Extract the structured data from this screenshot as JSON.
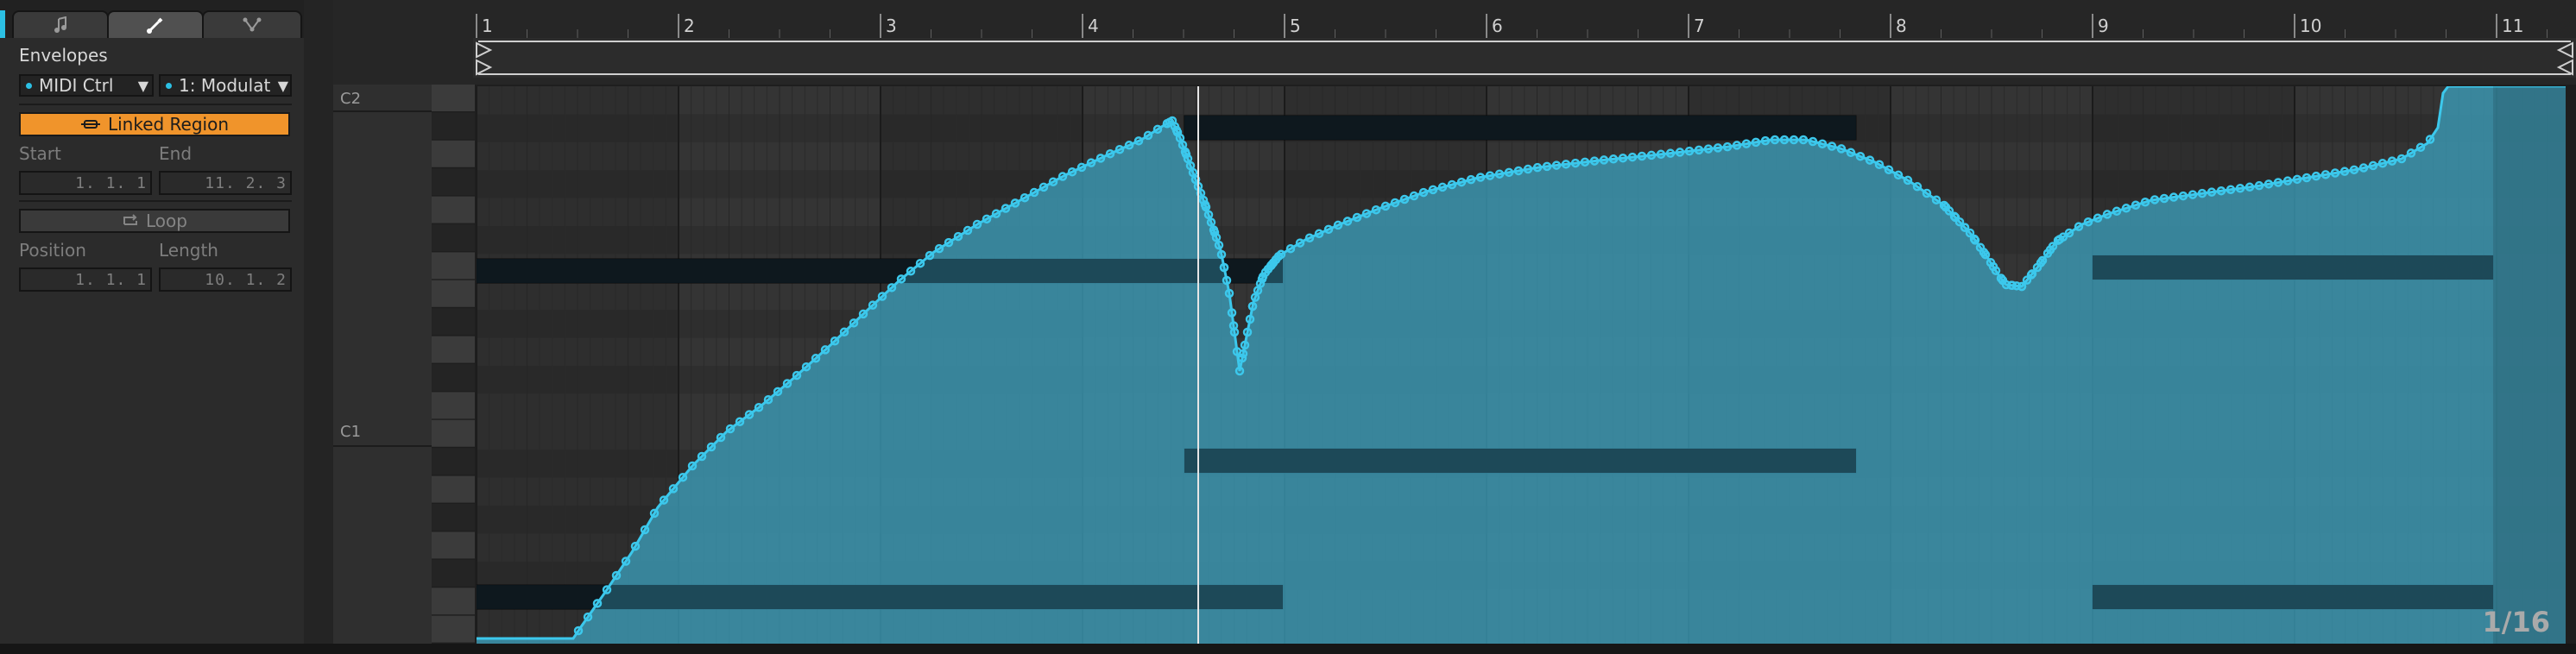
{
  "tabs": [
    {
      "name": "notes-tab",
      "icon": "music-note-icon"
    },
    {
      "name": "envelopes-tab",
      "icon": "pencil-icon",
      "active": true
    },
    {
      "name": "mpe-tab",
      "icon": "branch-icon"
    }
  ],
  "envelopes": {
    "title": "Envelopes",
    "device_label": "MIDI Ctrl",
    "control_label": "1: Modulat"
  },
  "region": {
    "linked_label": "Linked Region",
    "start_label": "Start",
    "end_label": "End",
    "start_value": "1.  1.  1",
    "end_value": "11.  2.  3",
    "loop_label": "Loop",
    "position_label": "Position",
    "length_label": "Length",
    "position_value": "1.  1.  1",
    "length_value": "10.  1.  2"
  },
  "keys": {
    "upper": "C2",
    "lower": "C1"
  },
  "ruler": {
    "bars": [
      "1",
      "2",
      "3",
      "4",
      "5",
      "6",
      "7",
      "8",
      "9",
      "10",
      "11"
    ]
  },
  "quantization": "1/16",
  "colors": {
    "accent": "#2cc0e4",
    "linked_region": "#f0942b",
    "envelope_fill": "#3c8ea4"
  }
}
